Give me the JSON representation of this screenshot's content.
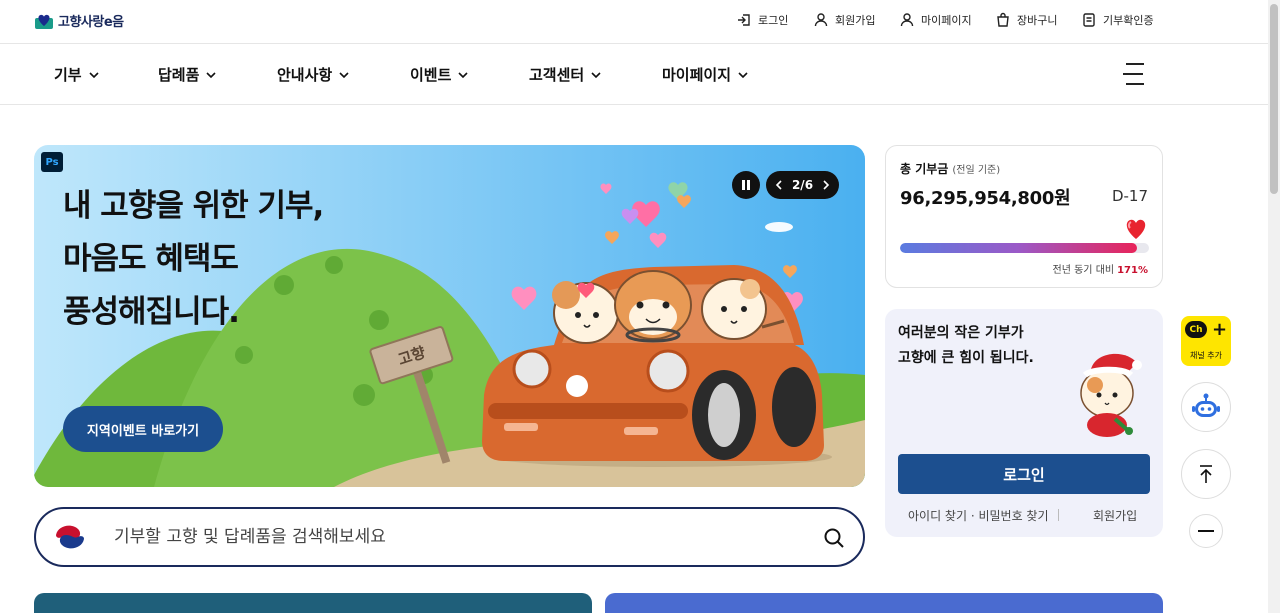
{
  "logo": {
    "text": "고향사랑e음"
  },
  "util_nav": [
    {
      "label": "로그인",
      "icon": "login-icon"
    },
    {
      "label": "회원가입",
      "icon": "person-icon"
    },
    {
      "label": "마이페이지",
      "icon": "person-icon"
    },
    {
      "label": "장바구니",
      "icon": "cart-icon"
    },
    {
      "label": "기부확인증",
      "icon": "document-icon"
    }
  ],
  "main_nav": [
    {
      "label": "기부"
    },
    {
      "label": "답례품"
    },
    {
      "label": "안내사항"
    },
    {
      "label": "이벤트"
    },
    {
      "label": "고객센터"
    },
    {
      "label": "마이페이지"
    }
  ],
  "hero": {
    "badge": "Ps",
    "title_lines": [
      "내 고향을 위한 기부,",
      "마음도 혜택도",
      "풍성해집니다."
    ],
    "sign_text": "고향",
    "button_label": "지역이벤트 바로가기",
    "pager": {
      "current": "2",
      "separator": "/",
      "total": "6"
    }
  },
  "search": {
    "placeholder": "기부할 고향 및 답례품을 검색해보세요"
  },
  "total": {
    "label": "총 기부금",
    "sub": "(전일 기준)",
    "amount": "96,295,954,800원",
    "dday": "D-17",
    "compare_label": "전년 동기 대비",
    "compare_value": "171%",
    "progress_fraction": 0.95
  },
  "login_card": {
    "message_lines": [
      "여러분의 작은 기부가",
      "고향에 큰 힘이 됩니다."
    ],
    "login_button": "로그인",
    "find_link": "아이디 찾기 · 비밀번호 찾기",
    "join_link": "회원가입"
  },
  "side": {
    "kakao_badge": "Ch",
    "kakao_label": "채널 추가"
  },
  "colors": {
    "primary": "#1c4f8f",
    "navy": "#1a2a5c",
    "accent_red": "#c8102e",
    "kakao": "#fee500"
  }
}
